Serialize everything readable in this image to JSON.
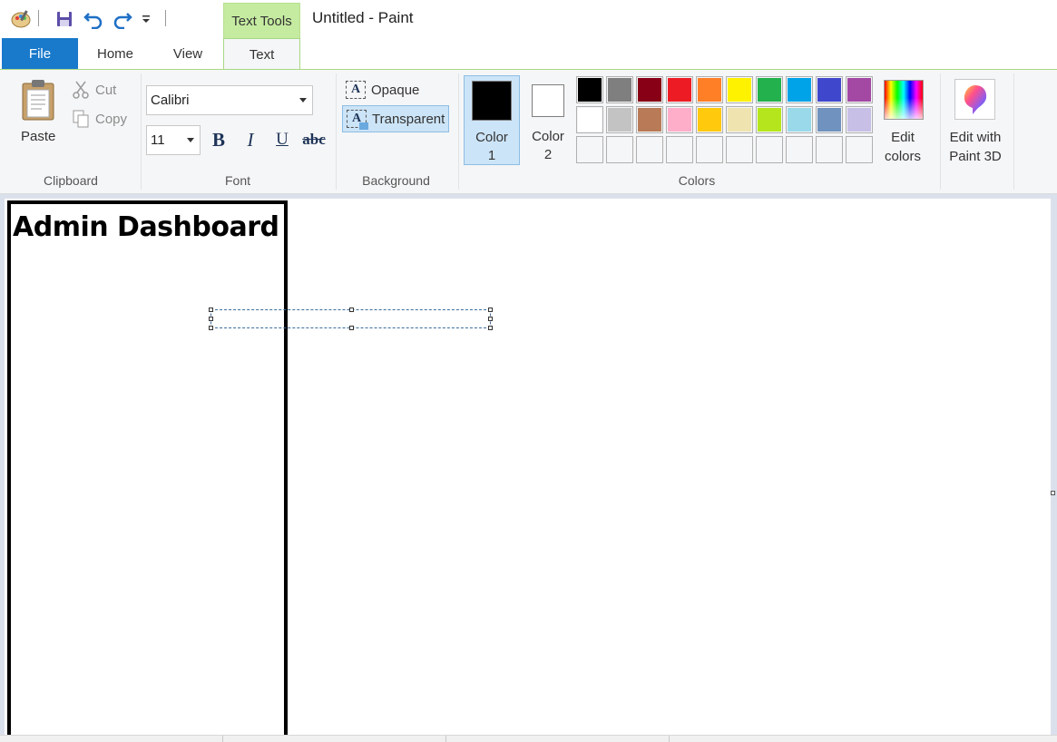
{
  "window": {
    "title": "Untitled - Paint",
    "contextual_tab": "Text Tools"
  },
  "quick_access": {
    "icons": [
      "paint-app-icon",
      "save-icon",
      "undo-icon",
      "redo-icon",
      "customize-dropdown-icon"
    ]
  },
  "tabs": [
    {
      "label": "File"
    },
    {
      "label": "Home"
    },
    {
      "label": "View"
    },
    {
      "label": "Text",
      "active": true
    }
  ],
  "ribbon": {
    "clipboard": {
      "group_label": "Clipboard",
      "paste": "Paste",
      "cut": "Cut",
      "copy": "Copy"
    },
    "font": {
      "group_label": "Font",
      "family": "Calibri",
      "size": "11",
      "bold": "B",
      "italic": "I",
      "underline": "U",
      "strikethrough": "abc"
    },
    "background": {
      "group_label": "Background",
      "opaque": "Opaque",
      "transparent": "Transparent",
      "selected": "Transparent"
    },
    "colors": {
      "group_label": "Colors",
      "color1_label": "Color\n1",
      "color1_line1": "Color",
      "color1_line2": "1",
      "color2_line1": "Color",
      "color2_line2": "2",
      "color1_value": "#000000",
      "color2_value": "#ffffff",
      "palette_row1": [
        "#000000",
        "#7f7f7f",
        "#880015",
        "#ed1c24",
        "#ff7f27",
        "#fff200",
        "#22b14c",
        "#00a2e8",
        "#3f48cc",
        "#a349a4"
      ],
      "palette_row2": [
        "#ffffff",
        "#c3c3c3",
        "#b97a57",
        "#ffaec9",
        "#ffc90e",
        "#efe4b0",
        "#b5e61d",
        "#99d9ea",
        "#7092be",
        "#c8bfe7"
      ],
      "edit_colors_line1": "Edit",
      "edit_colors_line2": "colors"
    },
    "paint3d": {
      "line1": "Edit with",
      "line2": "Paint 3D"
    }
  },
  "canvas": {
    "heading": "Admin Dashboard"
  }
}
